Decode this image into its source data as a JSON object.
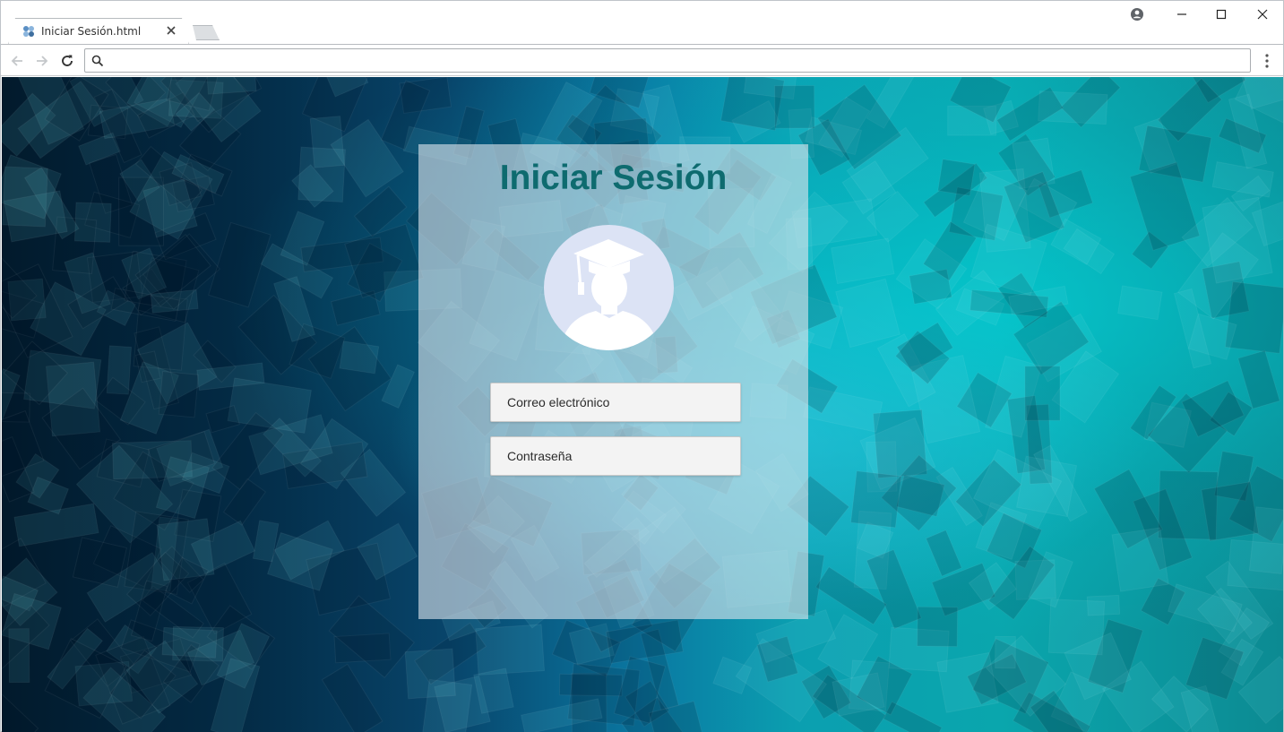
{
  "browser": {
    "tab_title": "Iniciar Sesión.html",
    "address_value": ""
  },
  "icons": {
    "favicon": "favicon-icon",
    "tab_close": "close-icon",
    "profile": "profile-icon",
    "minimize": "minimize-icon",
    "maximize": "maximize-icon",
    "window_close": "close-icon",
    "back": "back-arrow-icon",
    "forward": "forward-arrow-icon",
    "reload": "reload-icon",
    "search": "search-icon",
    "menu": "kebab-menu-icon",
    "avatar": "graduate-avatar-icon"
  },
  "login": {
    "title": "Iniciar Sesión",
    "email_placeholder": "Correo electrónico",
    "password_placeholder": "Contraseña"
  },
  "colors": {
    "title": "#0e6b6f",
    "avatar_bg": "#dce3f5"
  }
}
